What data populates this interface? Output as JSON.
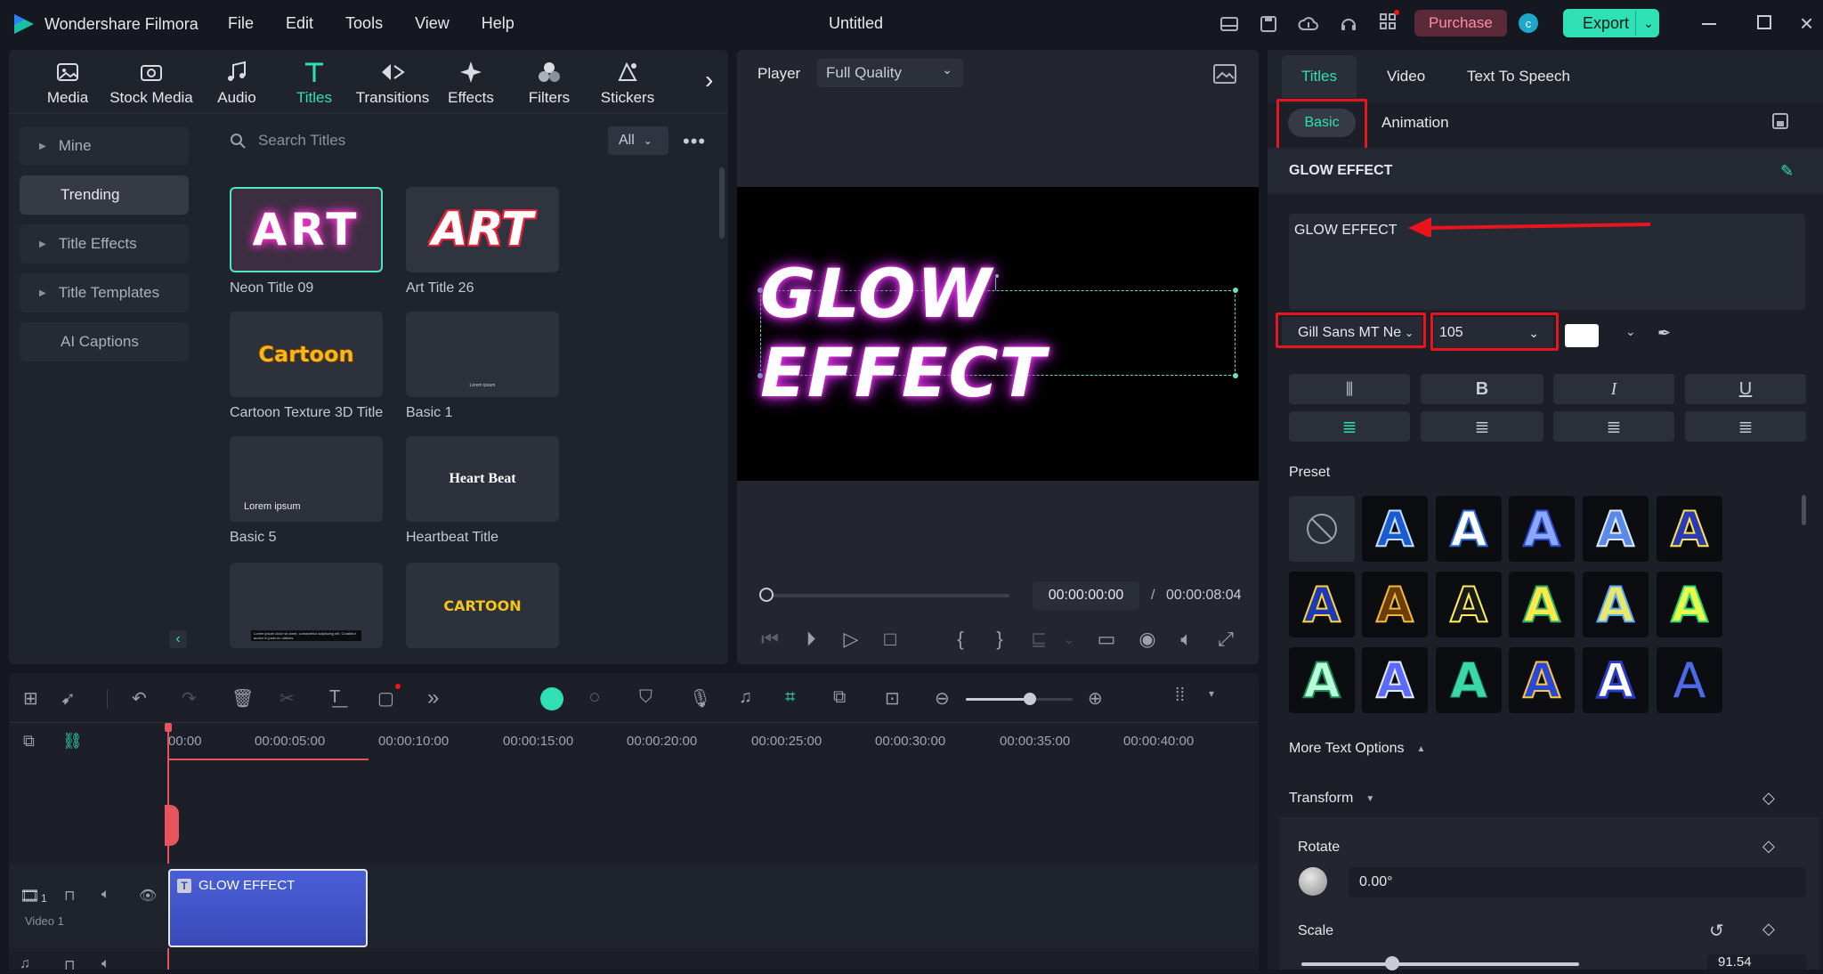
{
  "app": {
    "name": "Wondershare Filmora",
    "doc_title": "Untitled"
  },
  "menu": [
    "File",
    "Edit",
    "Tools",
    "View",
    "Help"
  ],
  "topbar": {
    "purchase": "Purchase",
    "avatar": "c",
    "export": "Export"
  },
  "media_tabs": [
    {
      "label": "Media",
      "icon": "media-icon"
    },
    {
      "label": "Stock Media",
      "icon": "stock-media-icon"
    },
    {
      "label": "Audio",
      "icon": "music-note-icon"
    },
    {
      "label": "Titles",
      "icon": "titles-t-icon"
    },
    {
      "label": "Transitions",
      "icon": "transitions-icon"
    },
    {
      "label": "Effects",
      "icon": "effects-sparkle-icon"
    },
    {
      "label": "Filters",
      "icon": "filters-icon"
    },
    {
      "label": "Stickers",
      "icon": "stickers-icon"
    }
  ],
  "categories": [
    "Mine",
    "Trending",
    "Title Effects",
    "Title Templates",
    "AI Captions"
  ],
  "search": {
    "placeholder": "Search Titles",
    "filter": "All"
  },
  "titles": [
    {
      "name": "Neon Title 09",
      "thumb": "ART"
    },
    {
      "name": "Art Title 26",
      "thumb": "ART"
    },
    {
      "name": "Cartoon Texture 3D Title",
      "thumb": "Cartoon"
    },
    {
      "name": "Basic 1",
      "thumb": "Lorem ipsum"
    },
    {
      "name": "Basic 5",
      "thumb": "Lorem ipsum"
    },
    {
      "name": "Heartbeat Title",
      "thumb": "Heart Beat"
    },
    {
      "name": "",
      "thumb": "Lorem ipsum dolor sit amet, consectetur adipiscing elit. Curabitur auctor in justo eu ultrices."
    },
    {
      "name": "",
      "thumb": "CARTOON"
    }
  ],
  "player": {
    "label": "Player",
    "quality": "Full Quality",
    "canvas_text": "GLOW EFFECT",
    "current_time": "00:00:00:00",
    "separator": "/",
    "total_time": "00:00:08:04"
  },
  "timeline": {
    "ruler": [
      "00:00",
      "00:00:05:00",
      "00:00:10:00",
      "00:00:15:00",
      "00:00:20:00",
      "00:00:25:00",
      "00:00:30:00",
      "00:00:35:00",
      "00:00:40:00"
    ],
    "track_label": "Video 1",
    "track_num": "1",
    "clip_label": "GLOW EFFECT",
    "zoom_fraction": 0.6
  },
  "right_panel": {
    "tabs": [
      "Titles",
      "Video",
      "Text To Speech"
    ],
    "subtabs": [
      "Basic",
      "Animation"
    ],
    "section_title": "GLOW EFFECT",
    "text_value": "GLOW EFFECT",
    "font": "Gill Sans MT Ne",
    "size": "105",
    "style_buttons": [
      "B",
      "I",
      "U"
    ],
    "preset_label": "Preset",
    "more_text": "More Text Options",
    "transform": "Transform",
    "rotate_label": "Rotate",
    "rotate_value": "0.00°",
    "scale_label": "Scale",
    "scale_value": "91.54",
    "colors": {
      "accent": "#00c9a7",
      "purchase_bg": "#5a2a38",
      "purchase_fg": "#ff8ba0",
      "export": "#2fe0b4",
      "highlight": "#e8141e",
      "clip": "#4a5ed8"
    }
  }
}
